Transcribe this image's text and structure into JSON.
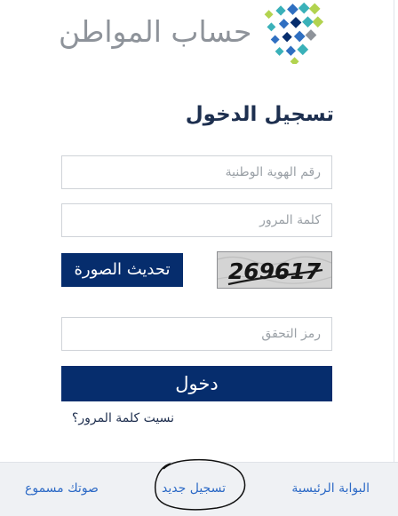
{
  "brand": {
    "name": "حساب المواطن",
    "logo_icon": "citizen-account-mosaic-logo",
    "colors": {
      "navy": "#062d6d",
      "blue": "#2f6fc1",
      "teal": "#3ab1b9",
      "green": "#b2d34f",
      "gray": "#8e939a",
      "link": "#2d6ac6"
    }
  },
  "login": {
    "title": "تسجيل الدخول",
    "national_id_placeholder": "رقم الهوية الوطنية",
    "password_placeholder": "كلمة المرور",
    "refresh_captcha_label": "تحديث الصورة",
    "captcha_text": "269617",
    "verification_placeholder": "رمز التحقق",
    "submit_label": "دخول",
    "forgot_password_label": "نسيت كلمة المرور؟"
  },
  "footer": {
    "home_label": "البوابة الرئيسية",
    "register_label": "تسجيل جديد",
    "voice_label": "صوتك مسموع"
  }
}
